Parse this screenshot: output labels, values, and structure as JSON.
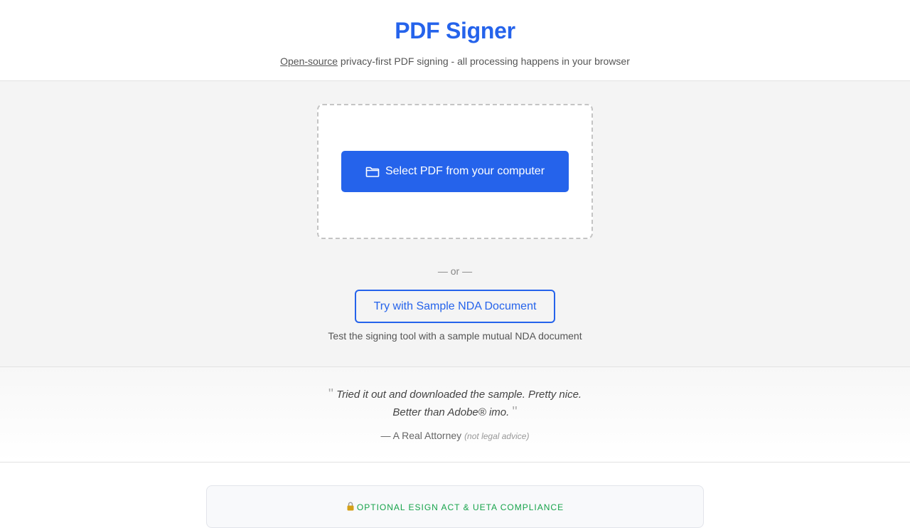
{
  "header": {
    "title": "PDF Signer",
    "subtitle_link": "Open-source",
    "subtitle_rest": " privacy-first PDF signing - all processing happens in your browser"
  },
  "upload": {
    "select_button_label": "Select PDF from your computer",
    "select_button_icon": "folder-icon",
    "divider": "— or —",
    "sample_button_label": "Try with Sample NDA Document",
    "sample_description": "Test the signing tool with a sample mutual NDA document"
  },
  "testimonial": {
    "open_quote": "\"",
    "line1": "Tried it out and downloaded the sample. Pretty nice.",
    "line2": "Better than Adobe® imo.",
    "close_quote": "\"",
    "author": "— A Real Attorney",
    "disclaimer": "(not legal advice)"
  },
  "compliance": {
    "icon": "lock-icon",
    "label": "OPTIONAL ESIGN ACT & UETA COMPLIANCE"
  },
  "colors": {
    "accent": "#2563eb",
    "compliance_green": "#16a34a"
  }
}
